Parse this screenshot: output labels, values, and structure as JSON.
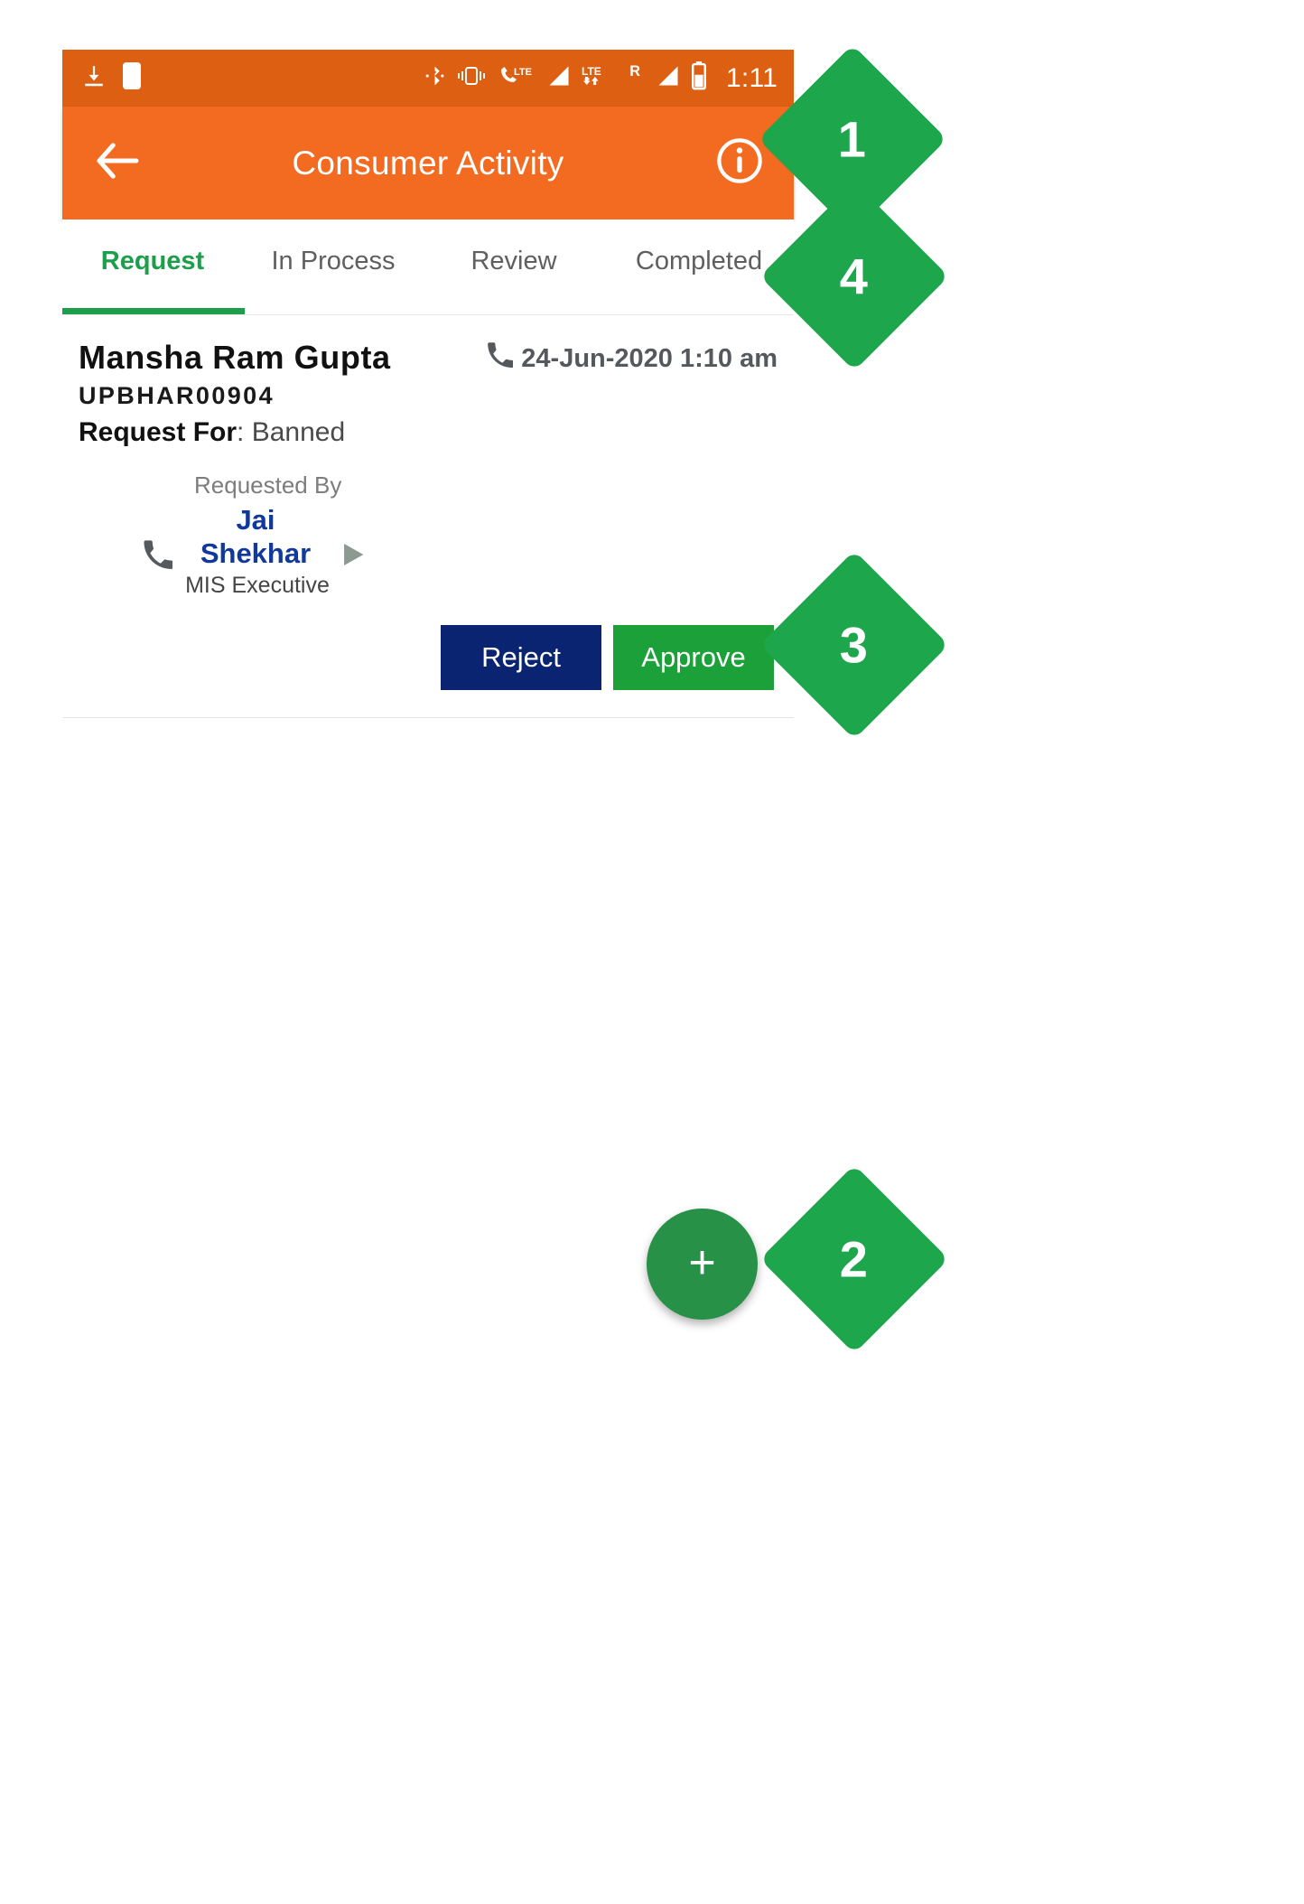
{
  "status_bar": {
    "time": "1:11",
    "left_icons": [
      "download-icon",
      "do-not-disturb-moon-icon"
    ],
    "right_icons": [
      "bluetooth-icon",
      "vibrate-icon",
      "lte-call-icon",
      "signal-bars-icon",
      "lte-data-arrows-icon",
      "roaming-r-icon",
      "signal-bars-2-icon",
      "battery-icon"
    ],
    "roaming_label": "R",
    "lte_label": "LTE",
    "background": "#DD5F12"
  },
  "app_bar": {
    "title": "Consumer Activity",
    "back_icon": "back-arrow-icon",
    "info_icon": "info-circle-icon",
    "background": "#F26B21"
  },
  "tabs": {
    "active_index": 0,
    "accent": "#1C9E4B",
    "items": [
      {
        "label": "Request"
      },
      {
        "label": "In Process"
      },
      {
        "label": "Review"
      },
      {
        "label": "Completed"
      }
    ]
  },
  "card": {
    "customer_name": "Mansha Ram Gupta",
    "customer_code": "UPBHAR00904",
    "request_for_label": "Request For",
    "request_for_value": ": Banned",
    "date_text": "24-Jun-2020 1:10 am",
    "date_icon": "phone-icon",
    "requested_by_label": "Requested By",
    "requested_by_name": "Jai Shekhar",
    "requested_by_role": "MIS Executive",
    "requested_by_phone_icon": "phone-icon",
    "play_icon": "play-triangle-icon",
    "name_color": "#11399B"
  },
  "actions": {
    "reject_label": "Reject",
    "reject_color": "#0A2472",
    "approve_label": "Approve",
    "approve_color": "#1CA13A"
  },
  "fab": {
    "label": "+",
    "color": "#279247"
  },
  "callouts": [
    {
      "number": "1"
    },
    {
      "number": "4"
    },
    {
      "number": "3"
    },
    {
      "number": "2"
    }
  ]
}
